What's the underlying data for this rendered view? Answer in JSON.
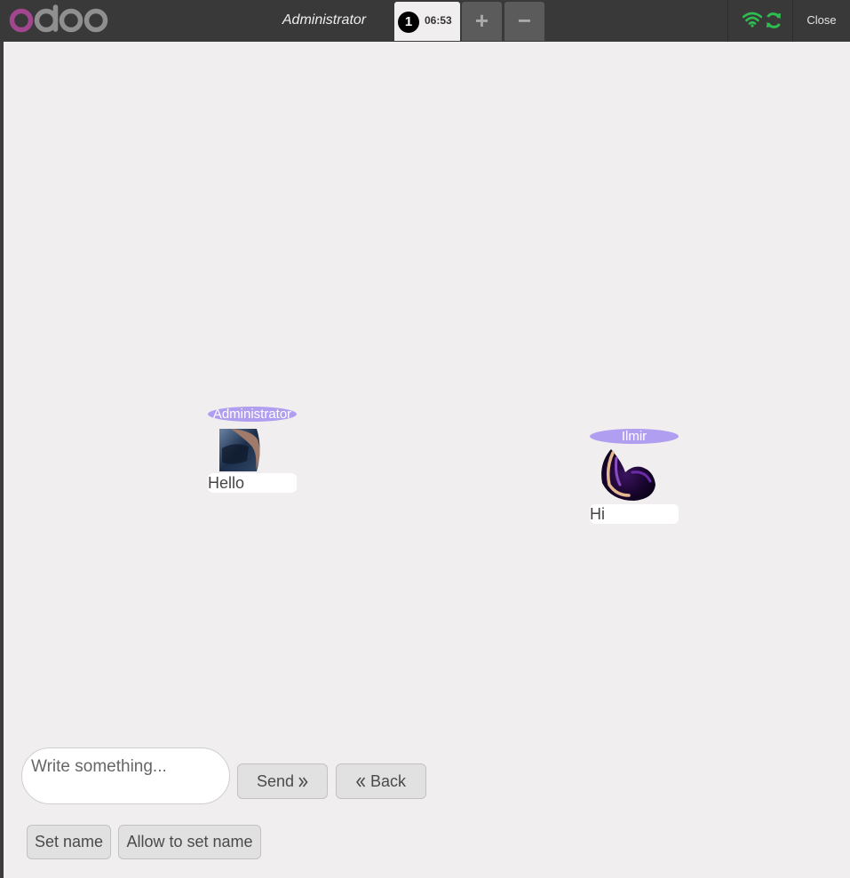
{
  "header": {
    "logo_text": "odoo",
    "cashier": "Administrator",
    "order": {
      "number": "1",
      "time": "06:53"
    },
    "add_order_symbol": "+",
    "remove_order_symbol": "−",
    "close_label": "Close",
    "status_icons": [
      "wifi-icon",
      "sync-icon"
    ],
    "colors": {
      "bar": "#393939",
      "status_ok": "#2ebd4e"
    }
  },
  "chat": {
    "users": [
      {
        "name": "Administrator",
        "message": "Hello"
      },
      {
        "name": "Ilmir",
        "message": "Hi"
      }
    ],
    "name_pill_color": "#b09ef0"
  },
  "controls": {
    "input_placeholder": "Write something...",
    "send_label": "Send",
    "back_label": "Back",
    "set_name_label": "Set name",
    "allow_set_name_label": "Allow to set name"
  }
}
